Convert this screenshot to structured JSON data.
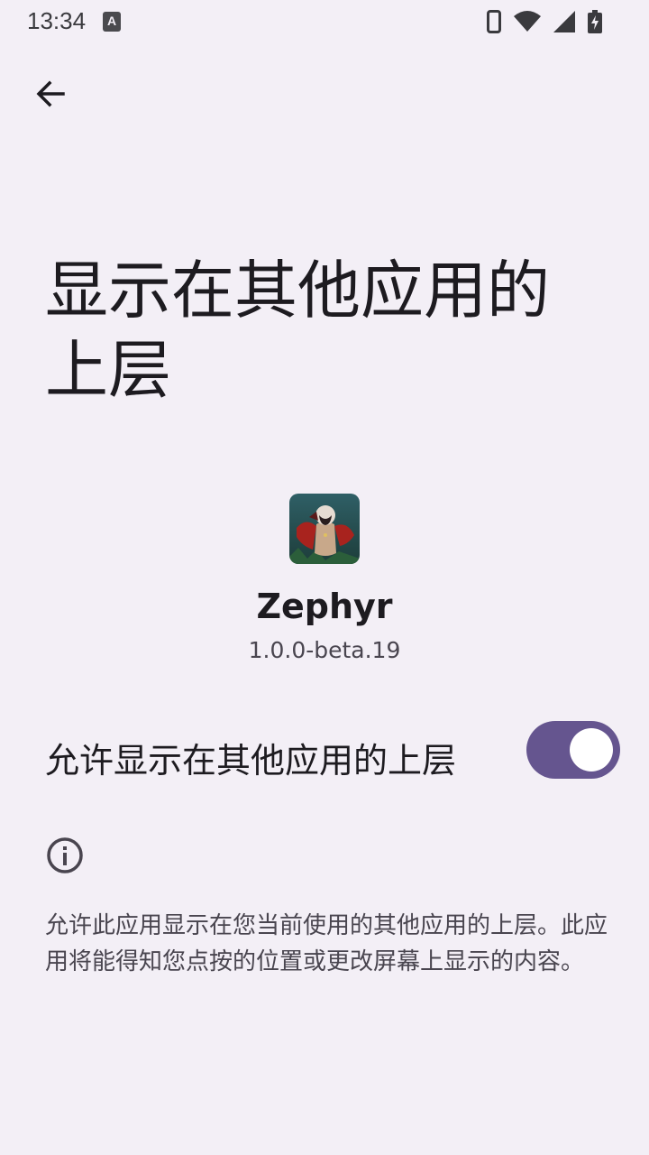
{
  "status_bar": {
    "time": "13:34",
    "notification_icon": "text-input-icon",
    "icons": [
      "phone-icon",
      "wifi-icon",
      "signal-icon",
      "battery-charging-icon"
    ]
  },
  "header": {
    "back_icon": "arrow-back-icon",
    "title": "显示在其他应用的上层"
  },
  "app": {
    "icon": "zephyr-app-icon",
    "name": "Zephyr",
    "version": "1.0.0-beta.19"
  },
  "permission": {
    "label": "允许显示在其他应用的上层",
    "enabled": true,
    "accent_color": "#65558f"
  },
  "info": {
    "icon": "info-icon",
    "description": "允许此应用显示在您当前使用的其他应用的上层。此应用将能得知您点按的位置或更改屏幕上显示的内容。"
  },
  "colors": {
    "background": "#f3eff6",
    "text_primary": "#1d1b20",
    "text_secondary": "#49454f"
  }
}
